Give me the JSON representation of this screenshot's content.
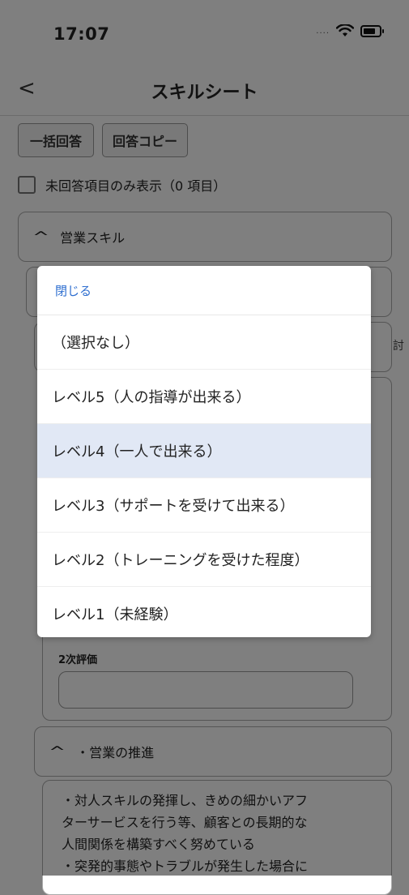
{
  "status": {
    "time": "17:07",
    "signal": "....",
    "wifi_icon": "wifi-icon",
    "battery_icon": "battery-icon"
  },
  "nav": {
    "back": "<",
    "title": "スキルシート"
  },
  "actions": {
    "bulk_answer": "一括回答",
    "copy_answer": "回答コピー"
  },
  "filter": {
    "label": "未回答項目のみ表示（0 項目）",
    "checked": false
  },
  "sections": {
    "sales_skill": "営業スキル",
    "sales_promotion": "・営業の推進",
    "edge_fragment": "討"
  },
  "evaluation": {
    "second_label": "2次評価",
    "second_value": ""
  },
  "description": {
    "lines": [
      "・対人スキルの発揮し、きめの細かいアフ",
      "ターサービスを行う等、顧客との長期的な",
      "人間関係を構築すべく努めている",
      "・突発的事態やトラブルが発生した場合に"
    ]
  },
  "picker": {
    "close": "閉じる",
    "selected_index": 2,
    "options": [
      "（選択なし）",
      "レベル5（人の指導が出来る）",
      "レベル4（一人で出来る）",
      "レベル3（サポートを受けて出来る）",
      "レベル2（トレーニングを受けた程度）",
      "レベル1（未経験）"
    ]
  }
}
